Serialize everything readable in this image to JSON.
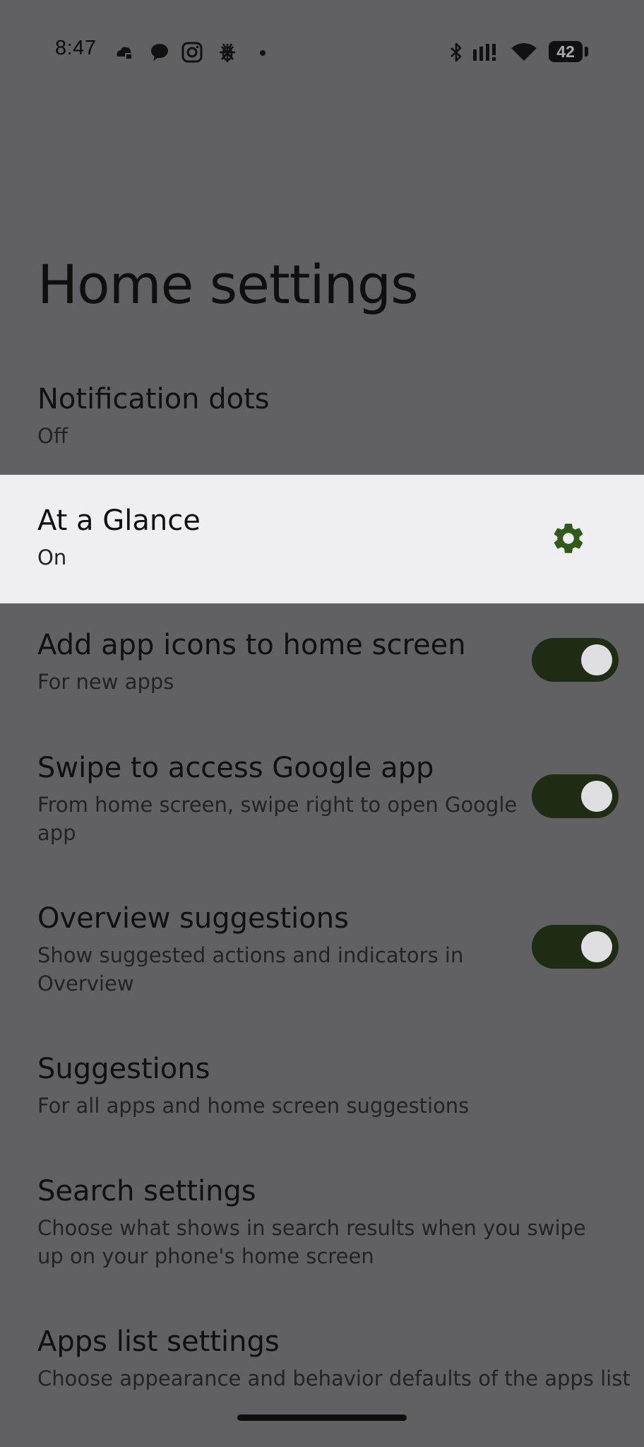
{
  "status_bar": {
    "time": "8:47",
    "battery": "42",
    "left_icons": [
      "cloud-app-icon",
      "chat-bubble-icon",
      "instagram-icon",
      "bug-icon",
      "dot-icon"
    ],
    "right_icons": [
      "bluetooth-icon",
      "signal-icon",
      "wifi-icon",
      "battery-icon"
    ]
  },
  "page": {
    "title": "Home settings"
  },
  "settings": [
    {
      "title": "Notification dots",
      "subtitle": "Off",
      "control": "none"
    },
    {
      "title": "At a Glance",
      "subtitle": "On",
      "control": "gear"
    },
    {
      "title": "Add app icons to home screen",
      "subtitle": "For new apps",
      "control": "toggle",
      "checked": true
    },
    {
      "title": "Swipe to access Google app",
      "subtitle": "From home screen, swipe right to open Google app",
      "control": "toggle",
      "checked": true
    },
    {
      "title": "Overview suggestions",
      "subtitle": "Show suggested actions and indicators in Overview",
      "control": "toggle",
      "checked": true
    },
    {
      "title": "Suggestions",
      "subtitle": "For all apps and home screen suggestions",
      "control": "none"
    },
    {
      "title": "Search settings",
      "subtitle": "Choose what shows in search results when you swipe up on your phone's home screen",
      "control": "none"
    },
    {
      "title": "Apps list settings",
      "subtitle": "Choose appearance and behavior defaults of the apps list",
      "control": "none"
    }
  ],
  "colors": {
    "background": "#616063",
    "highlight": "#efeef1",
    "toggle_track": "#1e2c14",
    "gear": "#2f5a1c"
  }
}
